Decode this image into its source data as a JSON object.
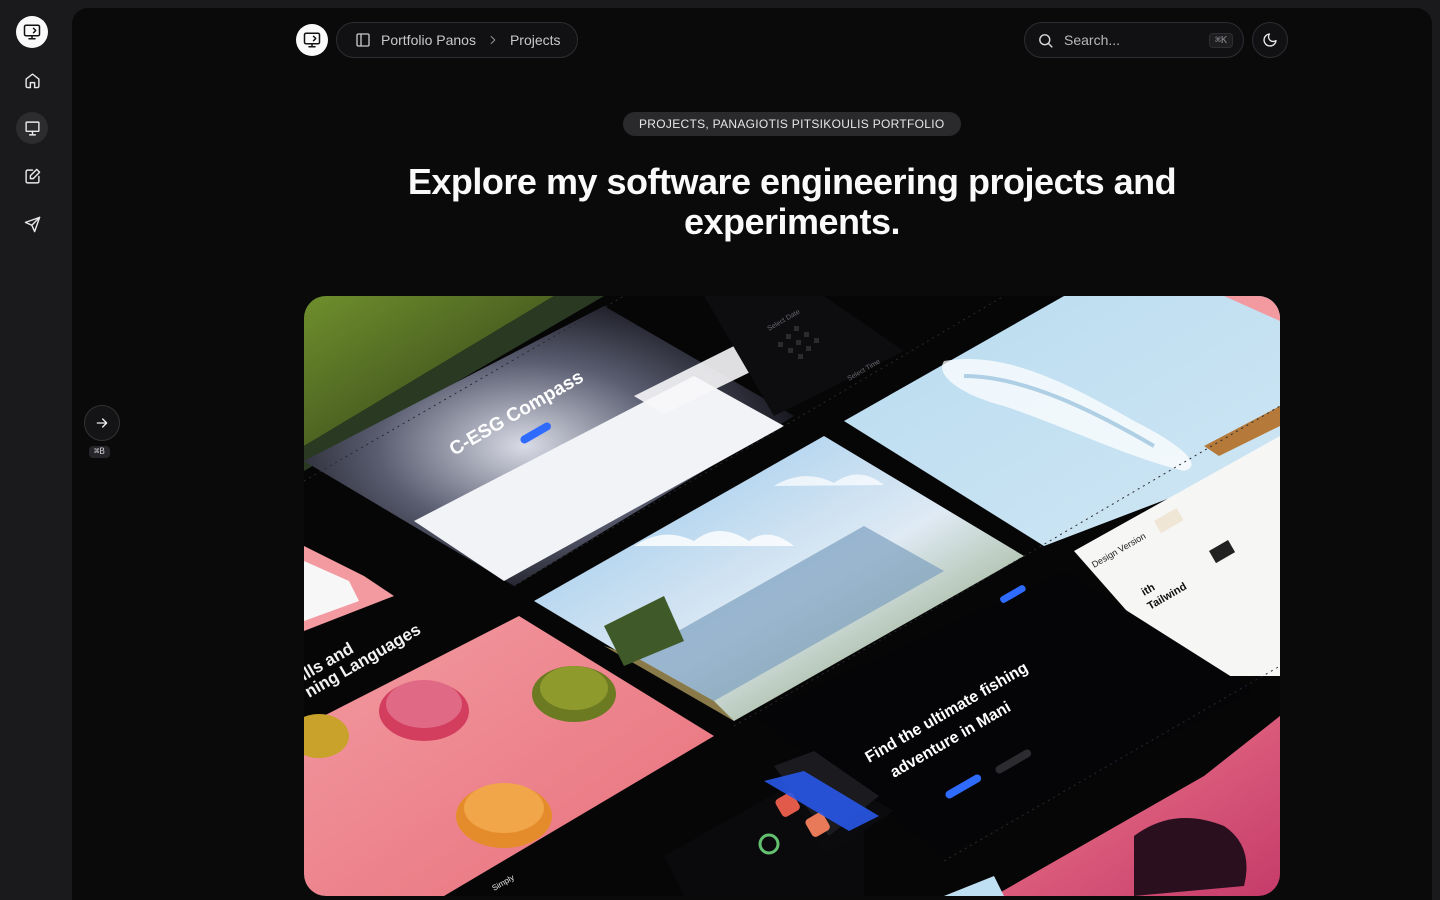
{
  "sidebar": {
    "items": [
      {
        "name": "home",
        "icon": "home-icon"
      },
      {
        "name": "projects",
        "icon": "presentation-icon",
        "active": true
      },
      {
        "name": "blog",
        "icon": "edit-icon"
      },
      {
        "name": "contact",
        "icon": "send-icon"
      }
    ]
  },
  "header": {
    "breadcrumb": [
      "Portfolio Panos",
      "Projects"
    ],
    "search_placeholder": "Search...",
    "search_shortcut": "⌘K"
  },
  "page": {
    "tag": "PROJECTS, PANAGIOTIS PITSIKOULIS PORTFOLIO",
    "headline": "Explore my software engineering projects and experiments."
  },
  "panel_toggle": {
    "shortcut": "⌘B"
  },
  "hero": {
    "card_texts": {
      "compass_title": "C-ESG Compass",
      "fishing_title_1": "Find the ultimate fishing",
      "fishing_title_2": "adventure in Mani",
      "skills_1": "ills and",
      "skills_2": "ning Languages",
      "design_1": "Design Version",
      "design_2": "ith",
      "design_3": "Tailwind",
      "calendar_label": "Select Date",
      "booking_label": "Select Time",
      "app_label": "Simply"
    }
  },
  "colors": {
    "background": "#1a1a1c",
    "panel": "#0a0a0b",
    "accent_blue": "#2f6bff",
    "pink": "#f07b8c"
  }
}
